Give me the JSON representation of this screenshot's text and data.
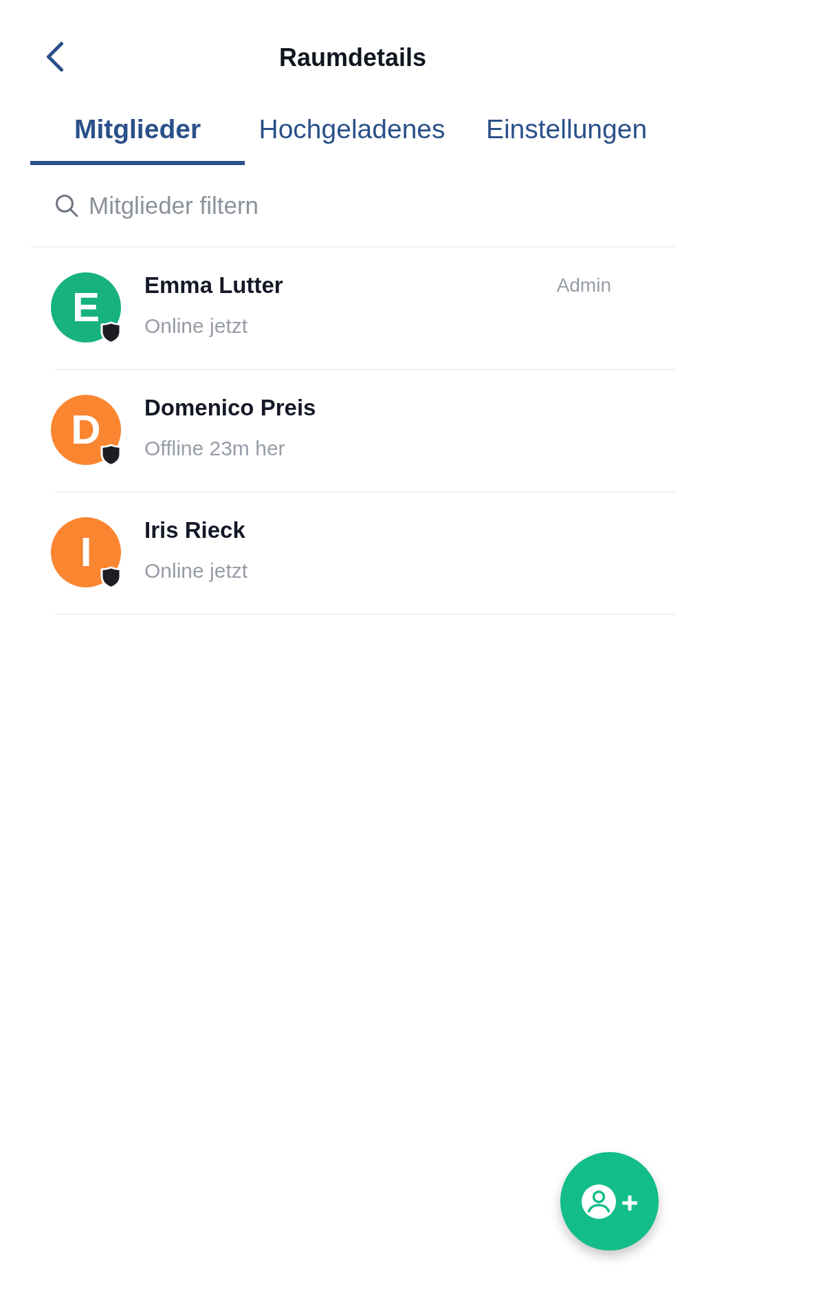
{
  "header": {
    "title": "Raumdetails"
  },
  "tabs": [
    {
      "label": "Mitglieder",
      "selected": true
    },
    {
      "label": "Hochgeladenes",
      "selected": false
    },
    {
      "label": "Einstellungen",
      "selected": false
    }
  ],
  "search": {
    "placeholder": "Mitglieder filtern"
  },
  "members": [
    {
      "initial": "E",
      "name": "Emma Lutter",
      "status": "Online jetzt",
      "role": "Admin",
      "color": "#17b27f"
    },
    {
      "initial": "D",
      "name": "Domenico Preis",
      "status": "Offline 23m her",
      "color": "#fa8631"
    },
    {
      "initial": "I",
      "name": "Iris Rieck",
      "status": "Online jetzt",
      "color": "#fa8631"
    }
  ]
}
